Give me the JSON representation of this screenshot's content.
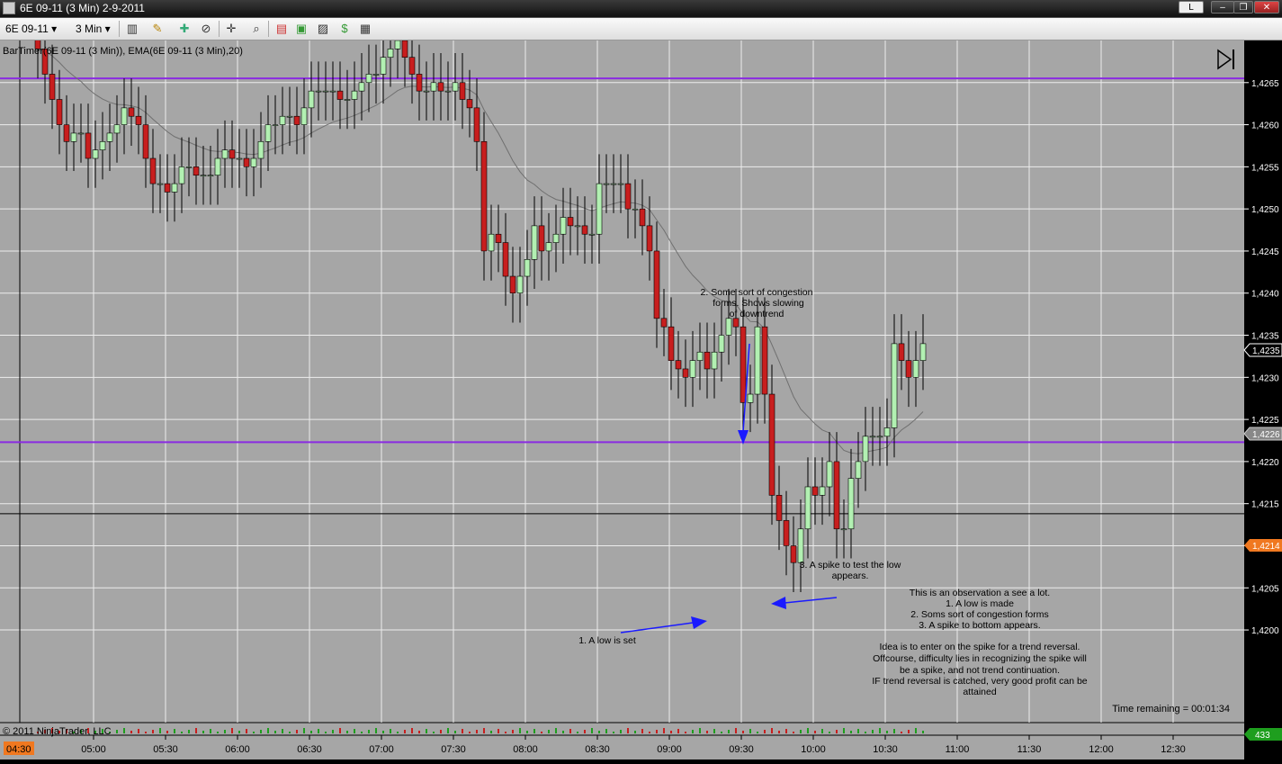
{
  "window": {
    "title": "6E 09-11 (3 Min)  2-9-2011",
    "controls": {
      "layout_label": "L",
      "minimize_label": "‒",
      "restore_label": "❐",
      "close_label": "✕"
    }
  },
  "toolbar": {
    "instrument": "6E 09-11",
    "interval": "3 Min",
    "icons": [
      "bar-type-icon",
      "pencil-icon",
      "globe-icon",
      "zoom-icon",
      "crosshair-icon",
      "magnifier-icon",
      "strategies-icon",
      "indicators-icon",
      "chart-properties-icon",
      "dollar-icon",
      "data-box-icon"
    ]
  },
  "chart": {
    "header_label": "BarTimer(6E 09-11 (3 Min)), EMA(6E 09-11 (3 Min),20)",
    "copyright": "© 2011 NinjaTrader, LLC",
    "time_remaining": "Time remaining = 00:01:34",
    "current_price_label": "1,4235",
    "ema_price_label": "1,4226",
    "crosshair_price_label": "1,4214",
    "crosshair_time_label": "04:30",
    "volume_label": "433",
    "annotations": [
      "2. Some sort of congestion",
      "forms. Shows slowing",
      "of downtrend",
      "3. A spike to test the low",
      "appears.",
      "1. A low is set",
      "This is an observation a see a lot.",
      "1. A low is made",
      "2. Soms sort of congestion forms",
      "3. A spike to bottom appears.",
      "Idea is to enter on the spike for a trend reversal.",
      "Offcourse, difficulty lies in recognizing the spike will",
      "be a spike, and not trend continuation.",
      "IF trend reversal is catched, very good profit can be",
      "attained"
    ],
    "colors": {
      "background": "#a6a6a6",
      "grid": "#ececec",
      "up_candle": "#b2f0b2",
      "down_candle": "#c81e1e",
      "ema": "#707070",
      "horizontal_lines": "#8a2be2",
      "arrows": "#1a1aff"
    }
  },
  "chart_data": {
    "type": "candlestick",
    "title": "",
    "xlabel": "",
    "ylabel": "",
    "x_ticks": [
      "05:00",
      "05:30",
      "06:00",
      "06:30",
      "07:00",
      "07:30",
      "08:00",
      "08:30",
      "09:00",
      "09:30",
      "10:00",
      "10:30",
      "11:00",
      "11:30",
      "12:00",
      "12:30"
    ],
    "y_ticks": [
      1.42,
      1.4205,
      1.421,
      1.4215,
      1.422,
      1.4225,
      1.423,
      1.4235,
      1.424,
      1.4245,
      1.425,
      1.4255,
      1.426,
      1.4265
    ],
    "ylim": [
      1.4189,
      1.427
    ],
    "horizontal_lines": [
      1.42655,
      1.42223
    ],
    "crosshair_price": 1.42138,
    "closes": [
      1.4269,
      1.4266,
      1.4263,
      1.426,
      1.4258,
      1.4259,
      1.4259,
      1.4256,
      1.4257,
      1.4258,
      1.4259,
      1.426,
      1.4262,
      1.4261,
      1.426,
      1.4256,
      1.4253,
      1.4253,
      1.4252,
      1.4253,
      1.4255,
      1.4255,
      1.4254,
      1.4254,
      1.4254,
      1.4256,
      1.4257,
      1.4256,
      1.4256,
      1.4255,
      1.4256,
      1.4258,
      1.426,
      1.426,
      1.4261,
      1.4261,
      1.426,
      1.4262,
      1.4264,
      1.4264,
      1.4264,
      1.4264,
      1.4263,
      1.4263,
      1.4264,
      1.4265,
      1.4266,
      1.4266,
      1.4268,
      1.4269,
      1.427,
      1.4268,
      1.4266,
      1.4264,
      1.4264,
      1.4265,
      1.4264,
      1.4264,
      1.4265,
      1.4263,
      1.4262,
      1.4258,
      1.4245,
      1.4247,
      1.4246,
      1.4242,
      1.424,
      1.4242,
      1.4244,
      1.4248,
      1.4245,
      1.4246,
      1.4247,
      1.4249,
      1.4248,
      1.4248,
      1.4247,
      1.4247,
      1.4253,
      1.4253,
      1.4253,
      1.4253,
      1.425,
      1.425,
      1.4248,
      1.4245,
      1.4237,
      1.4236,
      1.4232,
      1.4231,
      1.423,
      1.4232,
      1.4233,
      1.4231,
      1.4233,
      1.4235,
      1.4237,
      1.4236,
      1.4227,
      1.4228,
      1.4236,
      1.4228,
      1.4216,
      1.4213,
      1.421,
      1.4208,
      1.4212,
      1.4217,
      1.4216,
      1.4217,
      1.422,
      1.4212,
      1.4212,
      1.4218,
      1.422,
      1.4223,
      1.4223,
      1.4223,
      1.4224,
      1.4234,
      1.4232,
      1.423,
      1.4232,
      1.4234
    ]
  }
}
